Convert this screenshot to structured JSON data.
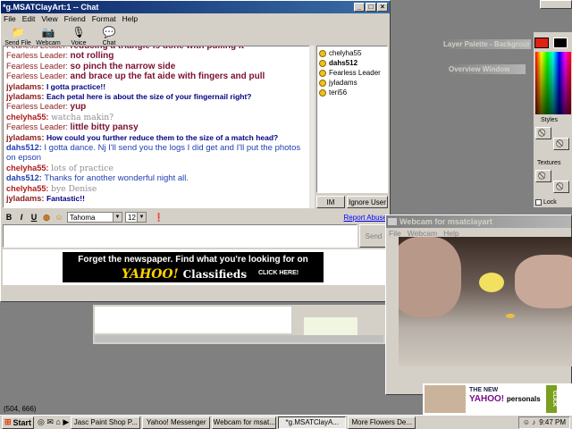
{
  "chat": {
    "title": "*g.MSATClayArt:1 -- Chat",
    "menu": [
      "File",
      "Edit",
      "View",
      "Friend",
      "Format",
      "Help"
    ],
    "toolbar": [
      {
        "label": "Send File",
        "icon": "send-file-icon"
      },
      {
        "label": "Webcam",
        "icon": "webcam-icon"
      },
      {
        "label": "Voice",
        "icon": "voice-icon"
      },
      {
        "label": "Chat",
        "icon": "chat-icon"
      }
    ],
    "messages": [
      {
        "who": "Fearless Leader:",
        "text": "reducing a triangle is done with pulling it",
        "kind": "fl"
      },
      {
        "who": "Fearless Leader:",
        "text": "not rolling",
        "kind": "fl"
      },
      {
        "who": "Fearless Leader:",
        "text": "so pinch the narrow side",
        "kind": "fl"
      },
      {
        "who": "Fearless Leader:",
        "text": "and brace up the fat aide with fingers and pull",
        "kind": "fl"
      },
      {
        "who": "jyladams:",
        "text": "I gotta practice!!",
        "kind": "jy"
      },
      {
        "who": "jyladams:",
        "text": "Each petal here is about the size of your fingernail right?",
        "kind": "jy"
      },
      {
        "who": "Fearless Leader:",
        "text": "yup",
        "kind": "fl"
      },
      {
        "who": "chelyha55:",
        "text": "watcha makin?",
        "kind": "ch"
      },
      {
        "who": "Fearless Leader:",
        "text": "little bitty pansy",
        "kind": "fl"
      },
      {
        "who": "jyladams:",
        "text": "How could you further reduce them to the size of a match head?",
        "kind": "jy"
      },
      {
        "who": "dahs512:",
        "text": "I gotta dance. Nj I'll send you the logs I did get and I'll put the photos on epson",
        "kind": "da"
      },
      {
        "who": "chelyha55:",
        "text": "lots of practice",
        "kind": "ch"
      },
      {
        "who": "dahs512:",
        "text": "Thanks for another wonderful night all.",
        "kind": "da"
      },
      {
        "who": "chelyha55:",
        "text": "bye Denise",
        "kind": "ch"
      },
      {
        "who": "jyladams:",
        "text": "Fantastic!!",
        "kind": "jy"
      }
    ],
    "users": [
      {
        "name": "chelyha55",
        "bold": false
      },
      {
        "name": "dahs512",
        "bold": true
      },
      {
        "name": "Fearless Leader",
        "bold": false
      },
      {
        "name": "jyladams",
        "bold": false
      },
      {
        "name": "teri56",
        "bold": false
      }
    ],
    "im_label": "IM",
    "ignore_label": "Ignore User",
    "format": {
      "bold": "B",
      "italic": "I",
      "underline": "U",
      "font": "Tahoma",
      "size": "12",
      "report": "Report Abuse"
    },
    "input_value": "",
    "send_label": "Send",
    "ad": {
      "line1": "Forget the newspaper. Find what you're looking for on",
      "logo": "YAHOO!",
      "logo_suffix": "Classifieds",
      "click": "CLICK HERE!"
    }
  },
  "psp": {
    "layer_palette": "Layer Palette - Background",
    "overview": "Overview Window",
    "styles": "Styles",
    "textures": "Textures",
    "lock": "Lock",
    "coords": "(504, 666)"
  },
  "webcam": {
    "title": "Webcam for msatclayart",
    "menu": [
      "File",
      "Webcam",
      "Help"
    ]
  },
  "ad2": {
    "line1": "THE NEW",
    "logo": "YAHOO!",
    "logo_suffix": "personals",
    "click": "CLICK"
  },
  "taskbar": {
    "start": "Start",
    "tasks": [
      {
        "label": "Jasc Paint Shop P...",
        "active": false
      },
      {
        "label": "Yahoo! Messenger",
        "active": false
      },
      {
        "label": "Webcam for msat...",
        "active": false
      },
      {
        "label": "*g.MSATClayA...",
        "active": true
      },
      {
        "label": "More Flowers De...",
        "active": false
      }
    ],
    "clock": "9:47 PM"
  },
  "colors": {
    "titlebar": "#0a246a",
    "fearless": "#7a1030",
    "dahs": "#1f3fb0",
    "jyl": "#000080"
  }
}
